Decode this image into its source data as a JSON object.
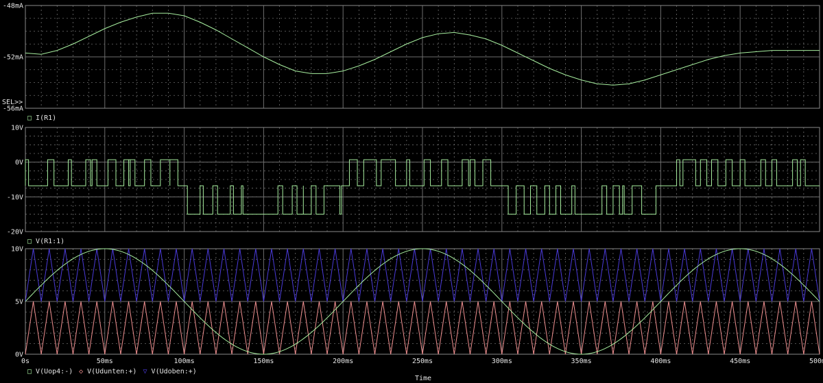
{
  "x_axis": {
    "label": "Time",
    "ticks": [
      "0s",
      "50ms",
      "100ms",
      "150ms",
      "200ms",
      "250ms",
      "300ms",
      "350ms",
      "400ms",
      "450ms",
      "500ms"
    ],
    "range_ms": [
      0,
      500
    ]
  },
  "sel_marker": "SEL>>",
  "colors": {
    "background": "#000000",
    "grid": "#6e6e6e",
    "green": "#a8f0a0",
    "red": "#f09090",
    "blue": "#4a3ad8",
    "axis_text": "#e6e6e6"
  },
  "chart_data": [
    {
      "type": "line",
      "title": "",
      "ylim": [
        -56,
        -48
      ],
      "y_unit": "mA",
      "y_ticks": [
        "-48mA",
        "-52mA",
        "-56mA"
      ],
      "grid": true,
      "legend": [
        {
          "symbol": "□",
          "name": "I(R1)",
          "color": "#a8f0a0"
        }
      ],
      "series": [
        {
          "name": "I(R1)",
          "x": [
            0,
            10,
            20,
            30,
            40,
            50,
            60,
            70,
            80,
            90,
            100,
            110,
            120,
            130,
            140,
            150,
            160,
            170,
            180,
            190,
            200,
            210,
            220,
            230,
            240,
            250,
            260,
            270,
            280,
            290,
            300,
            310,
            320,
            330,
            340,
            350,
            360,
            370,
            380,
            390,
            400,
            410,
            420,
            430,
            440,
            450,
            460,
            470,
            480,
            490,
            500
          ],
          "y": [
            -51.7,
            -51.8,
            -51.5,
            -51.0,
            -50.4,
            -49.8,
            -49.3,
            -48.9,
            -48.6,
            -48.6,
            -48.8,
            -49.3,
            -49.9,
            -50.6,
            -51.3,
            -52.0,
            -52.6,
            -53.1,
            -53.3,
            -53.3,
            -53.1,
            -52.7,
            -52.2,
            -51.6,
            -51.0,
            -50.5,
            -50.2,
            -50.1,
            -50.3,
            -50.6,
            -51.1,
            -51.7,
            -52.3,
            -52.9,
            -53.4,
            -53.8,
            -54.1,
            -54.2,
            -54.1,
            -53.8,
            -53.4,
            -53.0,
            -52.6,
            -52.2,
            -51.9,
            -51.7,
            -51.6,
            -51.5,
            -51.5,
            -51.5,
            -51.5
          ]
        }
      ]
    },
    {
      "type": "line",
      "title": "",
      "ylim": [
        -20,
        10
      ],
      "y_unit": "V",
      "y_ticks": [
        "10V",
        "0V",
        "-10V",
        "-20V"
      ],
      "grid": true,
      "legend": [
        {
          "symbol": "□",
          "name": "V(R1:1)",
          "color": "#a8f0a0"
        }
      ],
      "series": [
        {
          "name": "V(R1:1)",
          "levels_v": [
            0.7,
            -6.8,
            -10.0,
            -15.0
          ],
          "segments": [
            {
              "from_ms": 0,
              "to_ms": 100,
              "idle_v": -6.8,
              "pulse_v": 0.7,
              "pulses_ms": [
                [
                  0,
                  2
                ],
                [
                  14,
                  18
                ],
                [
                  27,
                  29
                ],
                [
                  38,
                  41
                ],
                [
                  42,
                  45
                ],
                [
                  52,
                  57
                ],
                [
                  62,
                  66
                ],
                [
                  65,
                  69
                ],
                [
                  75,
                  79
                ],
                [
                  85,
                  91
                ],
                [
                  91,
                  96
                ]
              ]
            },
            {
              "from_ms": 100,
              "to_ms": 200,
              "idle_v": -6.8,
              "pulse_v": -15.0,
              "pulses_ms": [
                [
                  102,
                  110
                ],
                [
                  112,
                  118
                ],
                [
                  121,
                  129
                ],
                [
                  131,
                  136
                ],
                [
                  137,
                  159
                ],
                [
                  162,
                  168
                ],
                [
                  171,
                  175
                ],
                [
                  175,
                  180
                ],
                [
                  183,
                  188
                ],
                [
                  198,
                  199
                ]
              ]
            },
            {
              "from_ms": 200,
              "to_ms": 300,
              "idle_v": -6.8,
              "pulse_v": 0.7,
              "pulses_ms": [
                [
                  204,
                  209
                ],
                [
                  213,
                  221
                ],
                [
                  224,
                  233
                ],
                [
                  240,
                  242
                ],
                [
                  251,
                  255
                ],
                [
                  262,
                  266
                ],
                [
                  275,
                  279
                ],
                [
                  280,
                  283
                ],
                [
                  288,
                  293
                ]
              ]
            },
            {
              "from_ms": 300,
              "to_ms": 400,
              "idle_v": -6.8,
              "pulse_v": -15.0,
              "pulses_ms": [
                [
                  304,
                  309
                ],
                [
                  314,
                  318
                ],
                [
                  322,
                  327
                ],
                [
                  330,
                  334
                ],
                [
                  337,
                  344
                ],
                [
                  346,
                  363
                ],
                [
                  366,
                  370
                ],
                [
                  374,
                  376
                ],
                [
                  377,
                  382
                ],
                [
                  388,
                  397
                ]
              ]
            },
            {
              "from_ms": 400,
              "to_ms": 500,
              "idle_v": -6.8,
              "pulse_v": 0.7,
              "pulses_ms": [
                [
                  410,
                  412
                ],
                [
                  414,
                  422
                ],
                [
                  425,
                  429
                ],
                [
                  432,
                  436
                ],
                [
                  441,
                  445
                ],
                [
                  450,
                  453
                ],
                [
                  463,
                  466
                ],
                [
                  470,
                  473
                ],
                [
                  483,
                  486
                ],
                [
                  488,
                  491
                ]
              ]
            }
          ]
        }
      ]
    },
    {
      "type": "line",
      "title": "",
      "ylim": [
        0,
        10
      ],
      "y_unit": "V",
      "y_ticks": [
        "10V",
        "5V",
        "0V"
      ],
      "grid": true,
      "legend": [
        {
          "symbol": "□",
          "name": "V(Uop4:-)",
          "color": "#a8f0a0"
        },
        {
          "symbol": "◇",
          "name": "V(Udunten:+)",
          "color": "#f09090"
        },
        {
          "symbol": "▽",
          "name": "V(Udoben:+)",
          "color": "#4a3ad8"
        }
      ],
      "series": [
        {
          "name": "V(Uop4:-)",
          "shape": "sine",
          "amplitude_v": 5,
          "offset_v": 5,
          "period_ms": 200,
          "peak_at_ms": 50
        },
        {
          "name": "V(Udunten:+)",
          "shape": "triangle",
          "min_v": 0,
          "max_v": 5,
          "period_ms": 10,
          "first_peak_ms": 5
        },
        {
          "name": "V(Udoben:+)",
          "shape": "triangle",
          "min_v": 5,
          "max_v": 10,
          "period_ms": 10,
          "first_peak_ms": 5
        }
      ]
    }
  ]
}
